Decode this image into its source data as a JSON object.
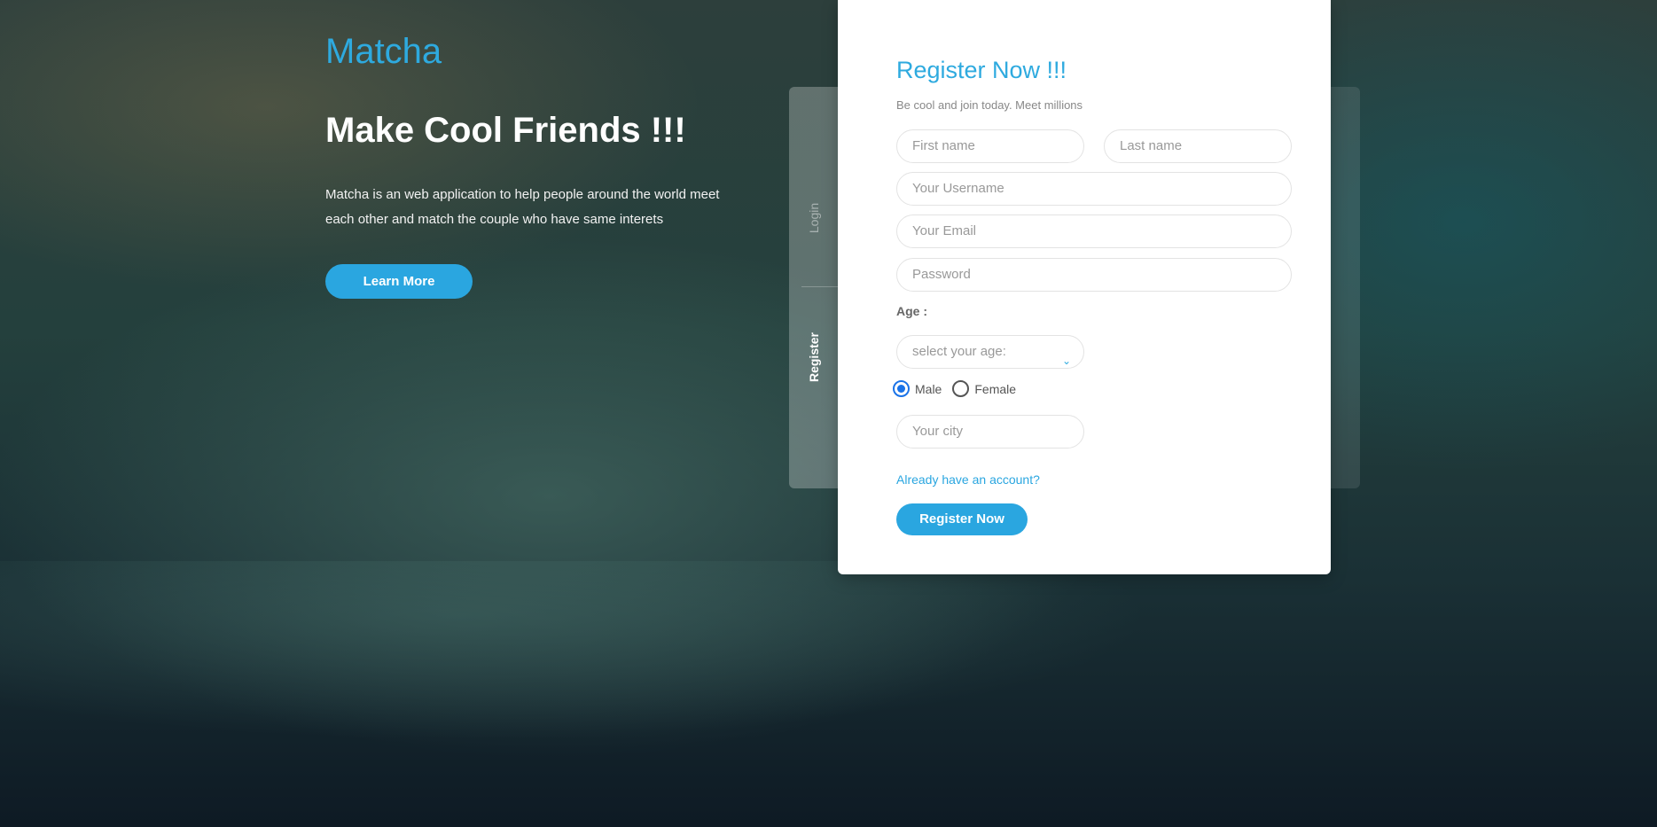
{
  "hero": {
    "brand": "Matcha",
    "headline": "Make Cool Friends !!!",
    "description": "Matcha is an web application to help people around the world meet each other and match the couple who have same interets",
    "learn_more_label": "Learn More"
  },
  "tabs": {
    "login_label": "Login",
    "register_label": "Register",
    "active": "Register"
  },
  "form": {
    "title": "Register Now !!!",
    "subtitle": "Be cool and join today. Meet millions",
    "first_name_placeholder": "First name",
    "last_name_placeholder": "Last name",
    "username_placeholder": "Your Username",
    "email_placeholder": "Your Email",
    "password_placeholder": "Password",
    "age_label": "Age :",
    "age_select_value": "select your age:",
    "gender_options": [
      "Male",
      "Female"
    ],
    "gender_selected": "Male",
    "city_placeholder": "Your city",
    "login_link": "Already have an account?",
    "submit_label": "Register Now"
  },
  "colors": {
    "accent": "#2eaadf",
    "radio_checked": "#1a73e8"
  }
}
